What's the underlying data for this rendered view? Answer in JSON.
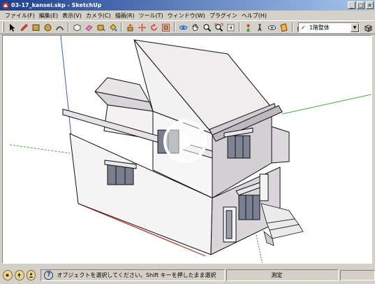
{
  "window": {
    "title": "03-17_kansei.skp - SketchUp",
    "controls": {
      "minimize": "_",
      "maximize": "□",
      "close": "×"
    }
  },
  "menu": {
    "items": [
      "ファイル(F)",
      "編集(E)",
      "表示(V)",
      "カメラ(C)",
      "描画(R)",
      "ツール(T)",
      "ウィンドウ(W)",
      "プラグイン",
      "ヘルプ(H)"
    ]
  },
  "toolbar": {
    "scene_selected": "1階整体",
    "scene_check": "✓",
    "dropdown_arrow": "▼",
    "tools": [
      "select-arrow-icon",
      "pencil-icon",
      "rectangle-icon",
      "circle-icon",
      "arc-icon",
      "make-component-icon",
      "eraser-icon",
      "tape-measure-icon",
      "paint-bucket-icon",
      "push-pull-icon",
      "move-icon",
      "rotate-icon",
      "offset-icon",
      "orbit-icon",
      "pan-icon",
      "zoom-icon",
      "zoom-extents-icon",
      "previous-view-icon",
      "position-camera-icon",
      "walk-icon",
      "look-around-icon",
      "section-plane-icon",
      "warehouse-icon",
      "components-icon"
    ]
  },
  "viewport": {
    "background": "#ffffff",
    "axis_colors": {
      "green": "#3fae3f",
      "red": "#c8271f",
      "blue": "#3b57c8"
    },
    "play_overlay": "play-icon"
  },
  "statusbar": {
    "help_symbol": "?",
    "message": "オブジェクトを選択してください。Shift キーを押したまま選択",
    "measure_label": "測定"
  }
}
